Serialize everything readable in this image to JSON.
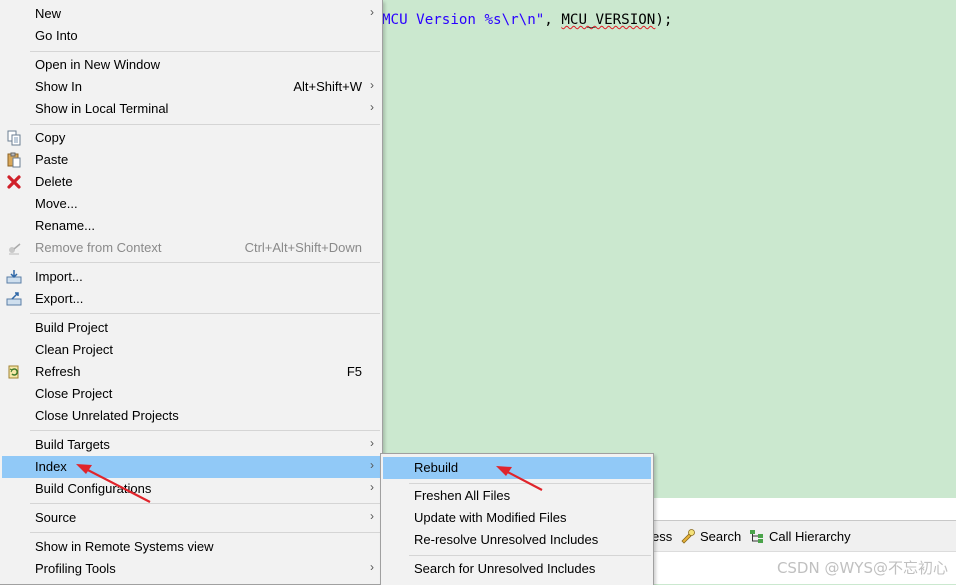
{
  "editor": {
    "code_string": "MCU Version %s\\r\\n\"",
    "code_sep": ", ",
    "code_macro": "MCU_VERSION",
    "code_tail": ");"
  },
  "context_menu": {
    "items": [
      {
        "label": "New",
        "shortcut": "",
        "icon": "",
        "submenu": true
      },
      {
        "label": "Go Into",
        "shortcut": "",
        "icon": "",
        "submenu": false
      },
      {
        "label": "Open in New Window",
        "shortcut": "",
        "icon": "",
        "submenu": false
      },
      {
        "label": "Show In",
        "shortcut": "Alt+Shift+W",
        "icon": "",
        "submenu": true
      },
      {
        "label": "Show in Local Terminal",
        "shortcut": "",
        "icon": "",
        "submenu": true
      },
      {
        "label": "Copy",
        "shortcut": "",
        "icon": "copy-icon",
        "submenu": false
      },
      {
        "label": "Paste",
        "shortcut": "",
        "icon": "paste-icon",
        "submenu": false
      },
      {
        "label": "Delete",
        "shortcut": "",
        "icon": "delete-icon",
        "submenu": false
      },
      {
        "label": "Move...",
        "shortcut": "",
        "icon": "",
        "submenu": false
      },
      {
        "label": "Rename...",
        "shortcut": "",
        "icon": "",
        "submenu": false
      },
      {
        "label": "Remove from Context",
        "shortcut": "Ctrl+Alt+Shift+Down",
        "icon": "remove-context-icon",
        "submenu": false,
        "disabled": true
      },
      {
        "label": "Import...",
        "shortcut": "",
        "icon": "import-icon",
        "submenu": false
      },
      {
        "label": "Export...",
        "shortcut": "",
        "icon": "export-icon",
        "submenu": false
      },
      {
        "label": "Build Project",
        "shortcut": "",
        "icon": "",
        "submenu": false
      },
      {
        "label": "Clean Project",
        "shortcut": "",
        "icon": "",
        "submenu": false
      },
      {
        "label": "Refresh",
        "shortcut": "F5",
        "icon": "refresh-icon",
        "submenu": false
      },
      {
        "label": "Close Project",
        "shortcut": "",
        "icon": "",
        "submenu": false
      },
      {
        "label": "Close Unrelated Projects",
        "shortcut": "",
        "icon": "",
        "submenu": false
      },
      {
        "label": "Build Targets",
        "shortcut": "",
        "icon": "",
        "submenu": true
      },
      {
        "label": "Index",
        "shortcut": "",
        "icon": "",
        "submenu": true,
        "highlighted": true
      },
      {
        "label": "Build Configurations",
        "shortcut": "",
        "icon": "",
        "submenu": true
      },
      {
        "label": "Source",
        "shortcut": "",
        "icon": "",
        "submenu": true
      },
      {
        "label": "Show in Remote Systems view",
        "shortcut": "",
        "icon": "",
        "submenu": false
      },
      {
        "label": "Profiling Tools",
        "shortcut": "",
        "icon": "",
        "submenu": true
      }
    ]
  },
  "index_submenu": {
    "items": [
      {
        "label": "Rebuild",
        "highlighted": true
      },
      {
        "label": "Freshen All Files"
      },
      {
        "label": "Update with Modified Files"
      },
      {
        "label": "Re-resolve Unresolved Includes"
      },
      {
        "label": "Search for Unresolved Includes"
      }
    ]
  },
  "bottom_tabs": {
    "partial_label": "ess",
    "search_label": "Search",
    "call_hierarchy_label": "Call Hierarchy"
  },
  "watermark": "CSDN @WYS@不忘初心",
  "colors": {
    "editor_bg": "#cbe8cf",
    "menu_bg": "#f2f2f2",
    "highlight": "#91c9f7",
    "annotation_arrow": "#e0242b"
  }
}
